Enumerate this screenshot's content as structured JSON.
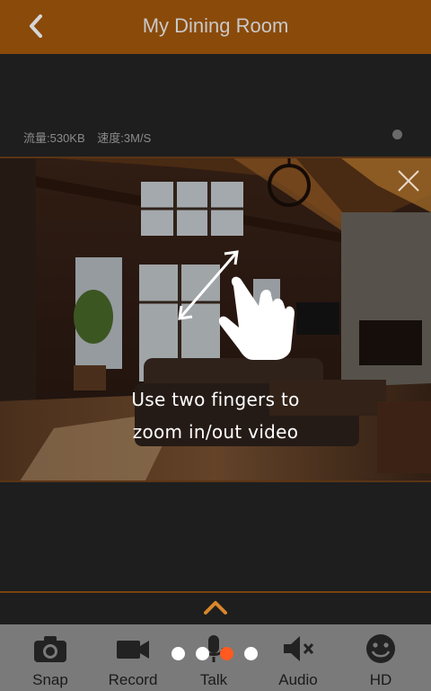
{
  "header": {
    "title": "My Dining Room"
  },
  "status": {
    "traffic": "流量:530KB",
    "speed": "速度:3M/S"
  },
  "overlay": {
    "hint_line1": "Use two fingers to",
    "hint_line2": "zoom in/out video"
  },
  "toolbar": {
    "items": [
      {
        "label": "Snap",
        "icon": "camera-icon"
      },
      {
        "label": "Record",
        "icon": "video-camera-icon"
      },
      {
        "label": "Talk",
        "icon": "microphone-icon"
      },
      {
        "label": "Audio",
        "icon": "speaker-muted-icon"
      },
      {
        "label": "HD",
        "icon": "smiley-icon"
      }
    ]
  },
  "pager": {
    "count": 4,
    "active_index": 2
  },
  "colors": {
    "accent": "#8a4a0a",
    "active_dot": "#ff5a1f",
    "toolbar_bg": "#7a7a7a"
  }
}
